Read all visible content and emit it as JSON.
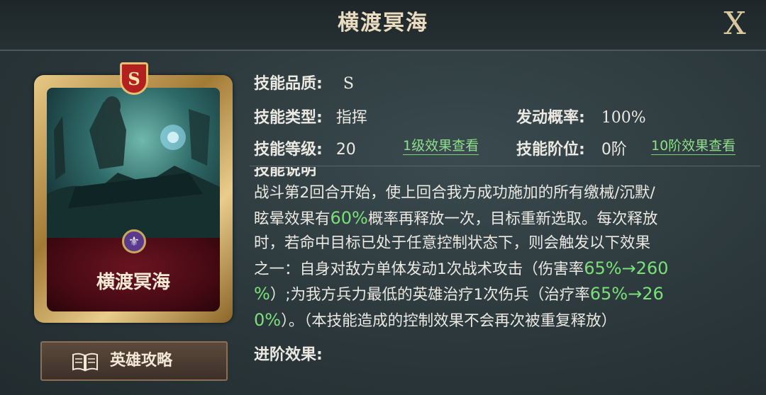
{
  "header": {
    "title": "横渡冥海",
    "close_label": "X"
  },
  "card": {
    "grade": "S",
    "name": "横渡冥海"
  },
  "guide_button": {
    "label": "英雄攻略",
    "icon": "book-icon"
  },
  "info": {
    "quality_label": "技能品质:",
    "quality_value": "S",
    "type_label": "技能类型:",
    "type_value": "指挥",
    "chance_label": "发动概率:",
    "chance_value": "100%",
    "level_label": "技能等级:",
    "level_value": "20",
    "level_link": "1级效果查看",
    "rank_label": "技能阶位:",
    "rank_value": "0阶",
    "rank_link": "10阶效果查看"
  },
  "description": {
    "heading": "技能说明",
    "line1": "战斗第2回合开始，使上回合我方成功施加的所有缴械/沉默/",
    "line2_a": "眩晕效果有",
    "line2_g": "60%",
    "line2_b": "概率再释放一次，目标重新选取。每次释放",
    "line3": "时，若命中目标已处于任意控制状态下，则会触发以下效果",
    "line4_a": "之一：自身对敌方单体发动1次战术攻击（伤害率",
    "line4_g": "65%→260",
    "line5_g1": "%",
    "line5_a": "）;为我方兵力最低的英雄治疗1次伤兵（治疗率",
    "line5_g2": "65%→26",
    "line6_g": "0%",
    "line6_a": "）。（本技能造成的控制效果不会再次被重复释放）"
  },
  "advance": {
    "label": "进阶效果:"
  },
  "colors": {
    "accent_green": "#7be07a",
    "gold": "#e7c985",
    "badge_red": "#b32020"
  }
}
